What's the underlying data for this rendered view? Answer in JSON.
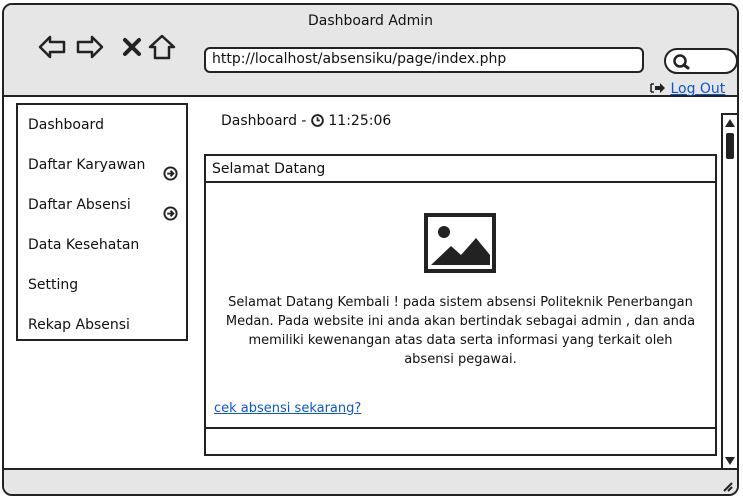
{
  "browser": {
    "title": "Dashboard Admin",
    "url": "http://localhost/absensiku/page/index.php",
    "icons": [
      "back-arrow-icon",
      "forward-arrow-icon",
      "close-icon",
      "home-icon",
      "search-icon"
    ]
  },
  "header": {
    "logout_label": "Log Out",
    "logout_icon": "sign-out-icon"
  },
  "sidebar": {
    "items": [
      {
        "label": "Dashboard"
      },
      {
        "label": "Daftar Karyawan",
        "icon": "circle-arrow-right-icon"
      },
      {
        "label": "Daftar Absensi",
        "icon": "circle-arrow-right-icon"
      },
      {
        "label": "Data Kesehatan"
      },
      {
        "label": "Setting"
      },
      {
        "label": "Rekap Absensi"
      }
    ]
  },
  "main": {
    "breadcrumb": "Dashboard -",
    "time": "11:25:06",
    "panel_title": "Selamat Datang",
    "welcome_text": "Selamat Datang Kembali ! pada sistem absensi Politeknik Penerbangan Medan. Pada website ini anda akan bertindak sebagai admin , dan anda memiliki kewenangan atas data serta informasi yang terkait oleh absensi pegawai.",
    "cta_link": "cek absensi sekarang?"
  }
}
